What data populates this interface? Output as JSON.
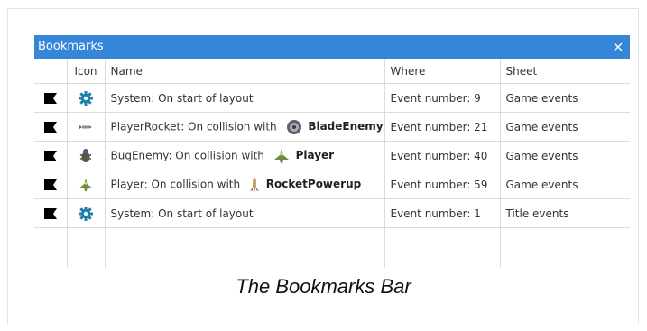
{
  "panel": {
    "title": "Bookmarks",
    "accent_color": "#3585d8",
    "close_icon": "close-icon"
  },
  "columns": {
    "flag": "",
    "icon": "Icon",
    "name": "Name",
    "where": "Where",
    "sheet": "Sheet"
  },
  "rows": [
    {
      "flag_icon": "bookmark-flag-icon",
      "icon": "gear-icon",
      "name_text": "System: On start of layout",
      "object_icon": "",
      "object_name": "",
      "where": "Event number: 9",
      "sheet": "Game events"
    },
    {
      "flag_icon": "bookmark-flag-icon",
      "icon": "rocket-icon",
      "name_text": "PlayerRocket: On collision with",
      "object_icon": "blade-enemy-icon",
      "object_name": "BladeEnemy",
      "where": "Event number: 21",
      "sheet": "Game events"
    },
    {
      "flag_icon": "bookmark-flag-icon",
      "icon": "bug-enemy-icon",
      "name_text": "BugEnemy: On collision with",
      "object_icon": "player-ship-icon",
      "object_name": "Player",
      "where": "Event number: 40",
      "sheet": "Game events"
    },
    {
      "flag_icon": "bookmark-flag-icon",
      "icon": "player-ship-icon",
      "name_text": "Player: On collision with",
      "object_icon": "rocket-powerup-icon",
      "object_name": "RocketPowerup",
      "where": "Event number: 59",
      "sheet": "Game events"
    },
    {
      "flag_icon": "bookmark-flag-icon",
      "icon": "gear-icon",
      "name_text": "System: On start of layout",
      "object_icon": "",
      "object_name": "",
      "where": "Event number: 1",
      "sheet": "Title events"
    }
  ],
  "caption": "The Bookmarks Bar"
}
